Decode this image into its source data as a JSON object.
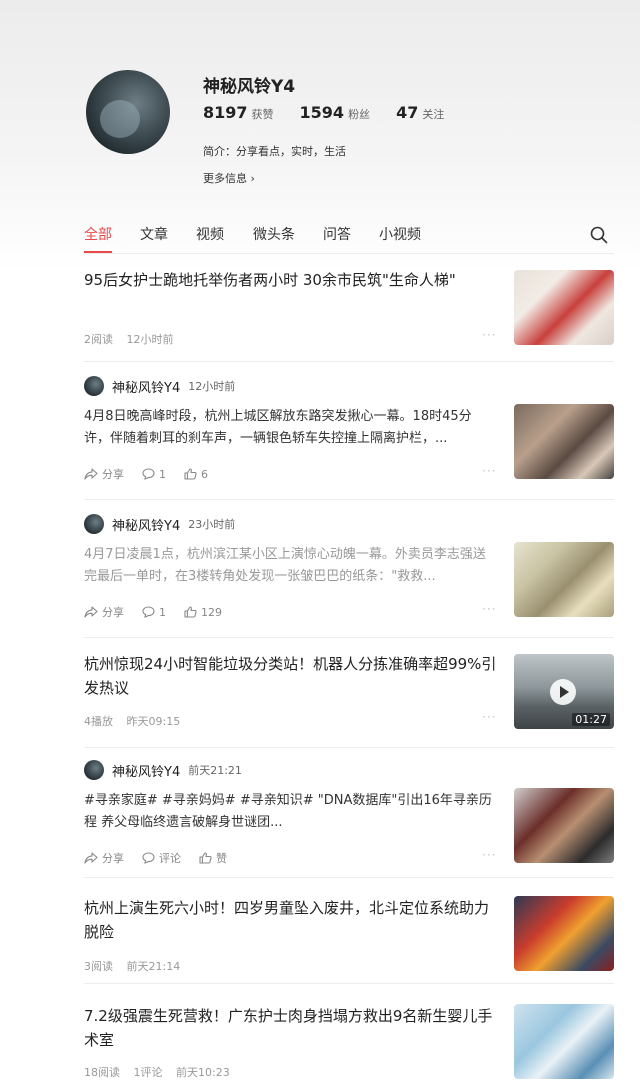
{
  "profile": {
    "name": "神秘风铃Y4",
    "stats": [
      {
        "value": "8197",
        "label": "获赞"
      },
      {
        "value": "1594",
        "label": "粉丝"
      },
      {
        "value": "47",
        "label": "关注"
      }
    ],
    "bio": "简介：分享看点，实时，生活",
    "more_info": "更多信息 ›"
  },
  "tabs": [
    "全部",
    "文章",
    "视频",
    "微头条",
    "问答",
    "小视频"
  ],
  "active_tab": "全部",
  "icons": {
    "search": "search-icon",
    "share": "share-icon",
    "comment": "comment-icon",
    "like": "thumbs-up-icon",
    "more": "more-dots-icon",
    "play": "play-icon"
  },
  "accent_color": "#e84a4a",
  "feed": {
    "item1": {
      "title": "95后女护士跪地托举伤者两小时 30余市民筑\"生命人梯\"",
      "reads": "2阅读",
      "time": "12小时前"
    },
    "item2": {
      "author": "神秘风铃Y4",
      "time": "12小时前",
      "text": "4月8日晚高峰时段，杭州上城区解放东路突发揪心一幕。18时45分许，伴随着刺耳的刹车声，一辆银色轿车失控撞上隔离护栏，...",
      "share": "分享",
      "comments": "1",
      "likes": "6"
    },
    "item3": {
      "author": "神秘风铃Y4",
      "time": "23小时前",
      "text": "4月7日凌晨1点，杭州滨江某小区上演惊心动魄一幕。外卖员李志强送完最后一单时，在3楼转角处发现一张皱巴巴的纸条：\"救救...",
      "share": "分享",
      "comments": "1",
      "likes": "129"
    },
    "item4": {
      "title": "杭州惊现24小时智能垃圾分类站！机器人分拣准确率超99%引发热议",
      "plays": "4播放",
      "time": "昨天09:15",
      "duration": "01:27"
    },
    "item5": {
      "author": "神秘风铃Y4",
      "time": "前天21:21",
      "text": "#寻亲家庭# #寻亲妈妈# #寻亲知识# \"DNA数据库\"引出16年寻亲历程 养父母临终遗言破解身世谜团...",
      "share": "分享",
      "comment": "评论",
      "like": "赞"
    },
    "item6": {
      "title": "杭州上演生死六小时！四岁男童坠入废井，北斗定位系统助力脱险",
      "reads": "3阅读",
      "time": "前天21:14"
    },
    "item7": {
      "title": "7.2级强震生死营救！广东护士肉身挡塌方救出9名新生婴儿手术室",
      "reads": "18阅读",
      "comments": "1评论",
      "time": "前天10:23"
    }
  }
}
